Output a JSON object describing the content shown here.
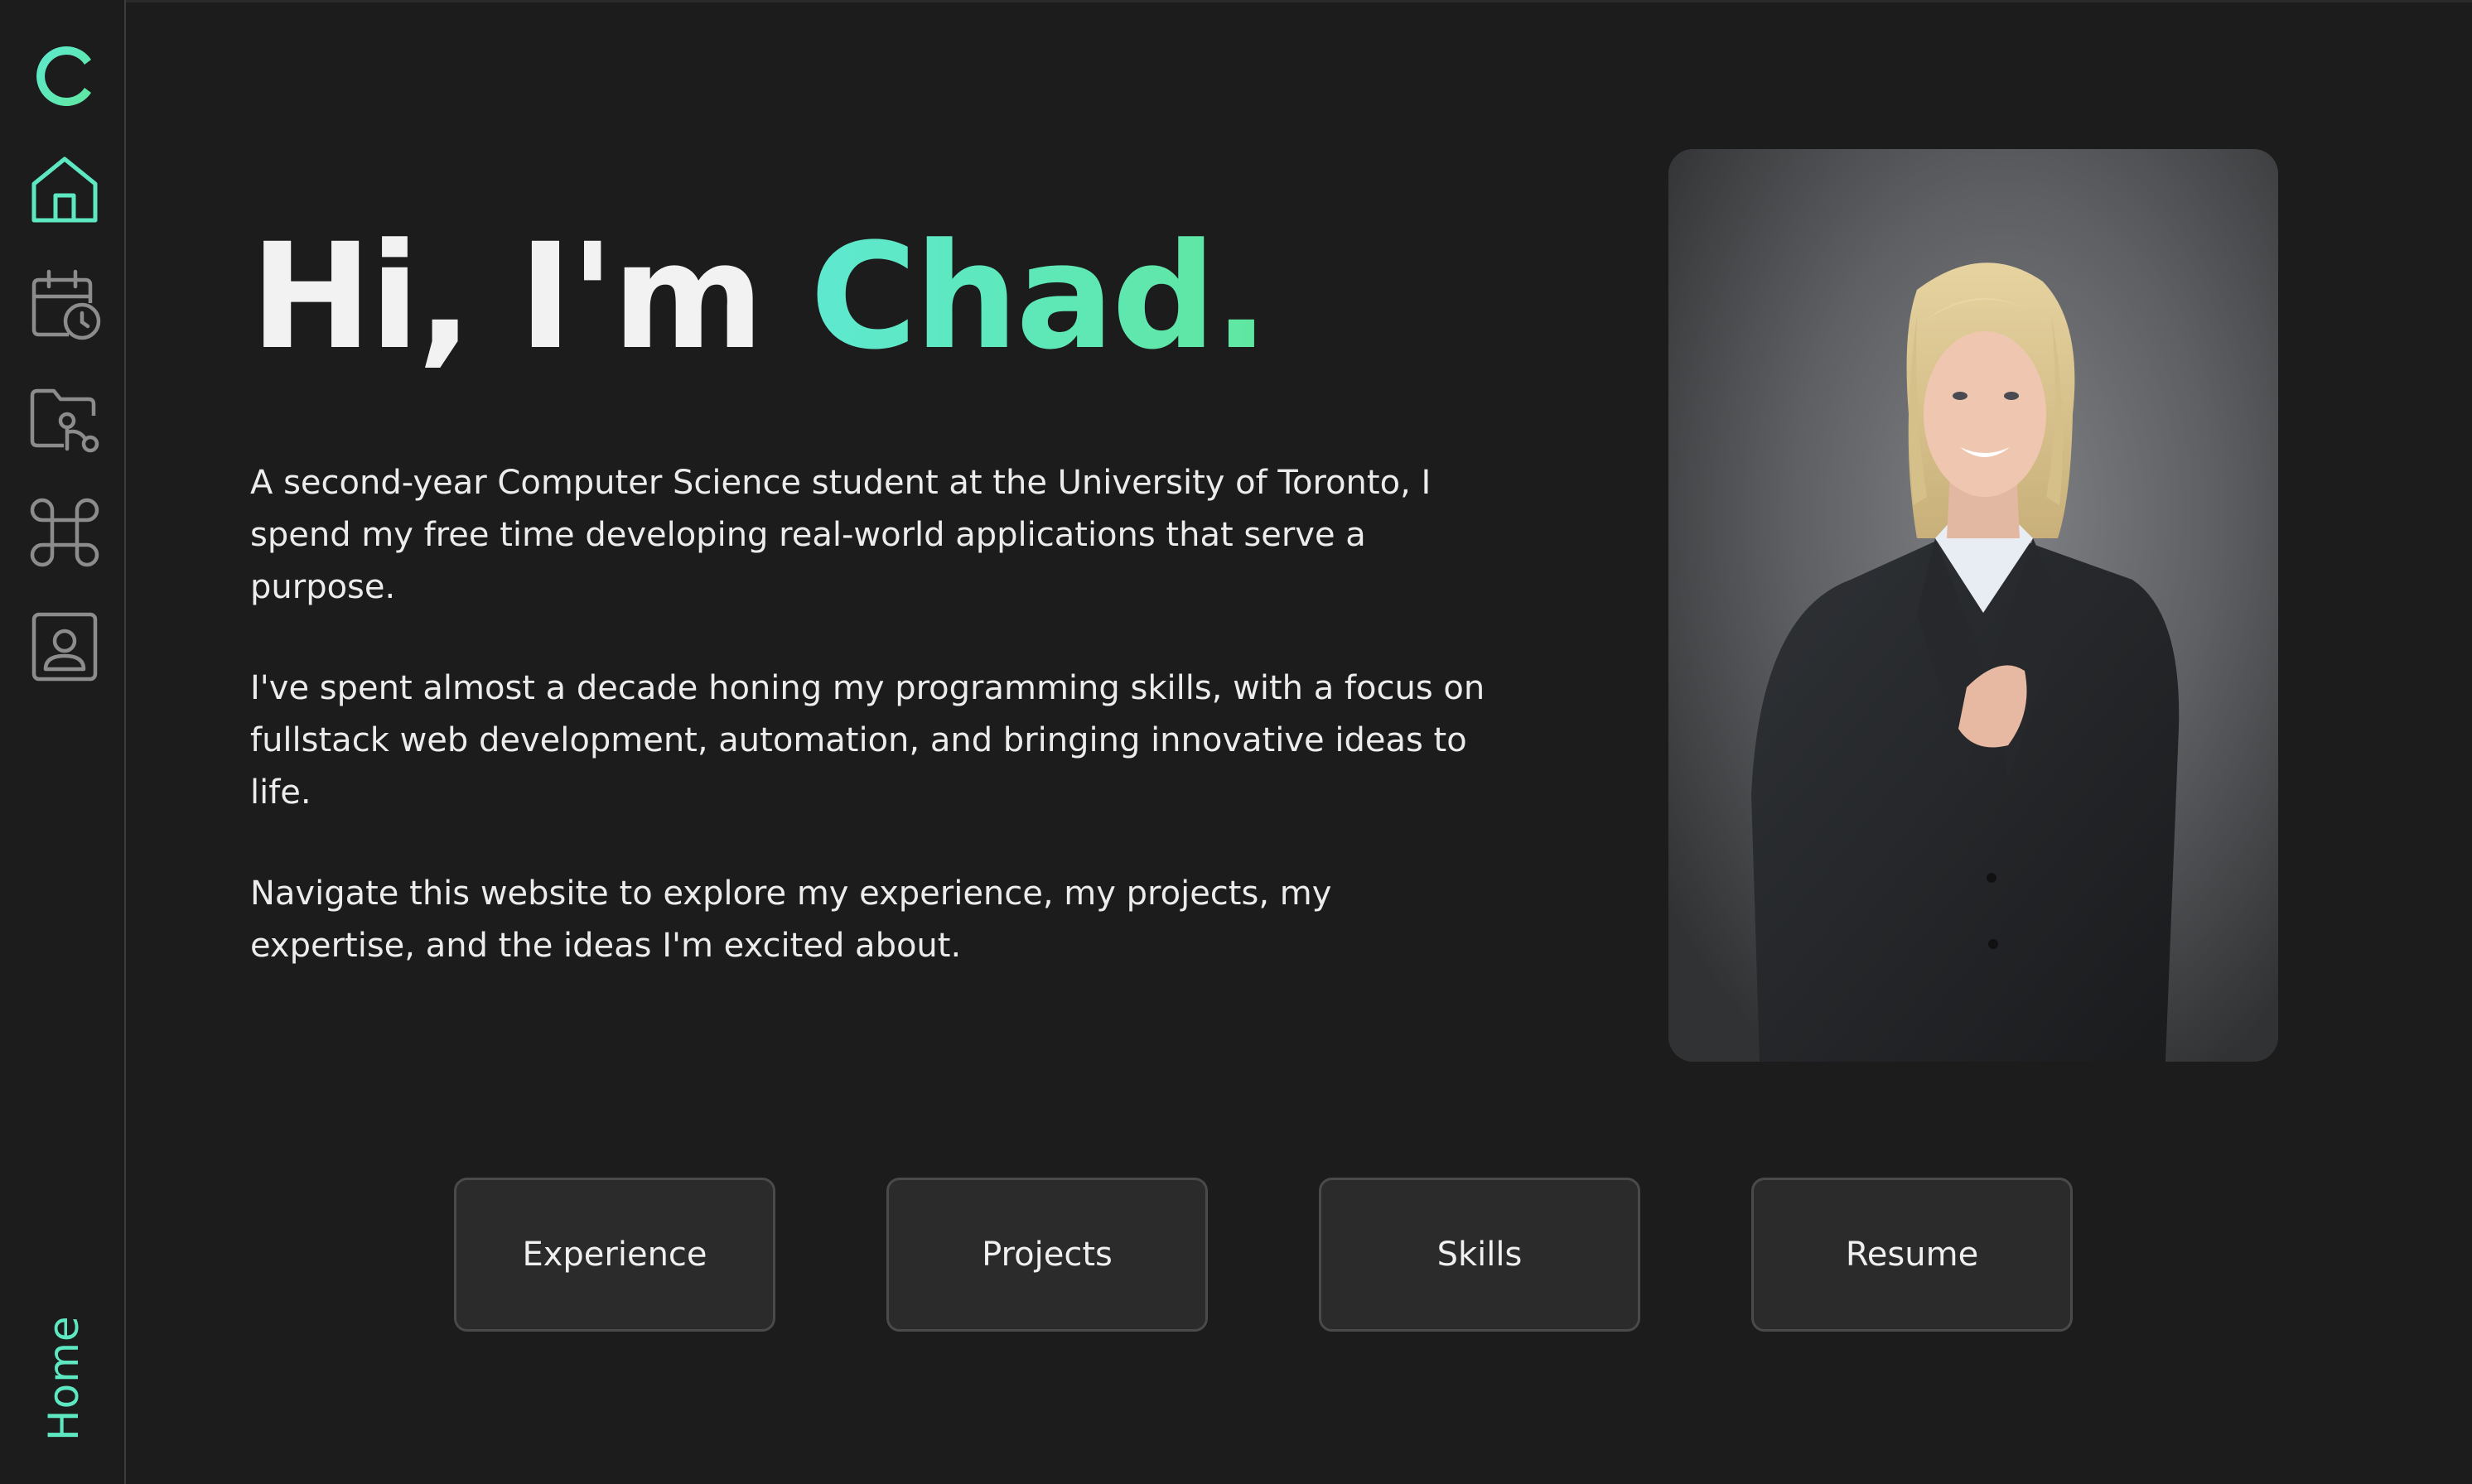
{
  "sidebar": {
    "logo_icon": "c-logo-icon",
    "items": [
      {
        "name": "home",
        "icon": "home-icon",
        "active": true
      },
      {
        "name": "experience",
        "icon": "calendar-clock-icon",
        "active": false
      },
      {
        "name": "projects",
        "icon": "folder-cursor-icon",
        "active": false
      },
      {
        "name": "skills",
        "icon": "command-icon",
        "active": false
      },
      {
        "name": "resume",
        "icon": "contact-card-icon",
        "active": false
      }
    ],
    "current_page": "Home"
  },
  "hero": {
    "greeting": "Hi, I'm ",
    "name": "Chad.",
    "paragraphs": [
      "A second-year Computer Science student at the University of Toronto, I spend my free time developing real-world applications that serve a purpose.",
      "I've spent almost a decade honing my programming skills, with a focus on fullstack web development, automation, and bringing innovative ideas to life.",
      "Navigate this website to explore my experience, my projects, my expertise, and the ideas I'm excited about."
    ]
  },
  "buttons": {
    "experience": "Experience",
    "projects": "Projects",
    "skills": "Skills",
    "resume": "Resume"
  },
  "colors": {
    "accent_start": "#5ee8d0",
    "accent_end": "#5fe7a0",
    "background": "#1c1c1c",
    "icon_active": "#5ee8c2",
    "icon_inactive": "#8c8c8c"
  }
}
